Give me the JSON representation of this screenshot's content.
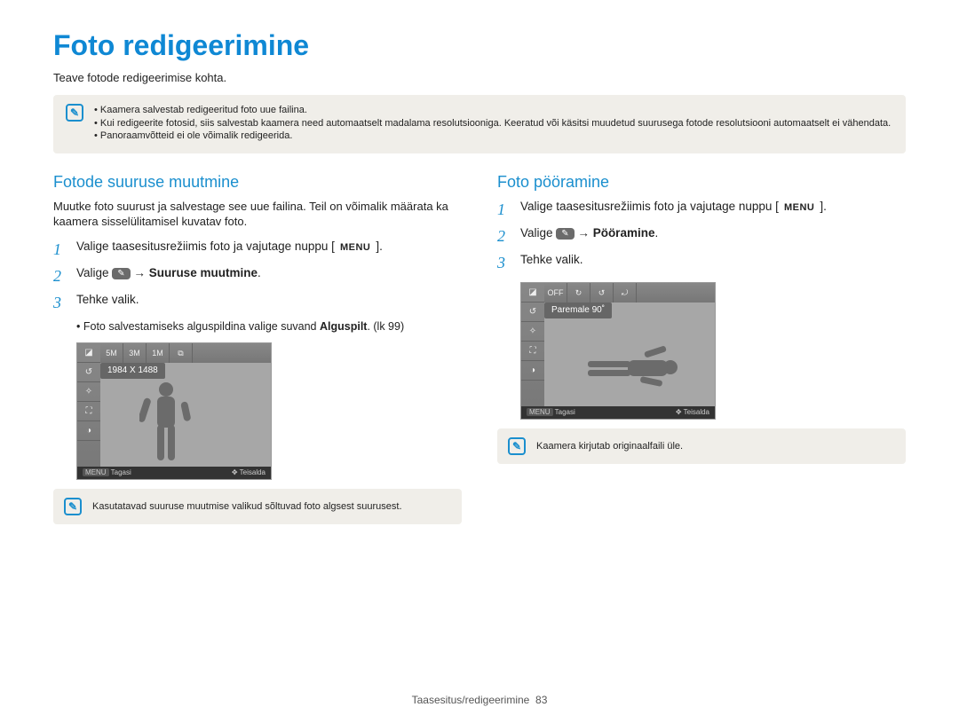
{
  "page": {
    "title": "Foto redigeerimine",
    "subtitle": "Teave fotode redigeerimise kohta.",
    "footer_section": "Taasesitus/redigeerimine",
    "footer_page": "83"
  },
  "top_info": {
    "items": [
      "Kaamera salvestab redigeeritud foto uue failina.",
      "Kui redigeerite fotosid, siis salvestab kaamera need automaatselt madalama resolutsiooniga. Keeratud või käsitsi muudetud suurusega fotode resolutsiooni automaatselt ei vähendata.",
      "Panoraamvõtteid ei ole võimalik redigeerida."
    ]
  },
  "resize": {
    "heading": "Fotode suuruse muutmine",
    "desc": "Muutke foto suurust ja salvestage see uue failina. Teil on võimalik määrata ka kaamera sisselülitamisel kuvatav foto.",
    "step1_pre": "Valige taasesitusrežiimis foto ja vajutage nuppu ",
    "step1_btn": "MENU",
    "step2_pre": "Valige ",
    "step2_arrow": " → ",
    "step2_bold": "Suuruse muutmine",
    "step3": "Tehke valik.",
    "bullet_pre": "Foto salvestamiseks alguspildina valige suvand ",
    "bullet_bold": "Alguspilt",
    "bullet_suffix": ". (lk 99)",
    "screenshot": {
      "label": "1984 X 1488",
      "back": "Tagasi",
      "move": "Teisalda",
      "menu": "MENU"
    },
    "note": "Kasutatavad suuruse muutmise valikud sõltuvad foto algsest suurusest."
  },
  "rotate": {
    "heading": "Foto pööramine",
    "step1_pre": "Valige taasesitusrežiimis foto ja vajutage nuppu ",
    "step1_btn": "MENU",
    "step2_pre": "Valige ",
    "step2_arrow": " → ",
    "step2_bold": "Pööramine",
    "step3": "Tehke valik.",
    "screenshot": {
      "label": "Paremale 90˚",
      "back": "Tagasi",
      "move": "Teisalda",
      "menu": "MENU"
    },
    "note": "Kaamera kirjutab originaalfaili üle."
  }
}
